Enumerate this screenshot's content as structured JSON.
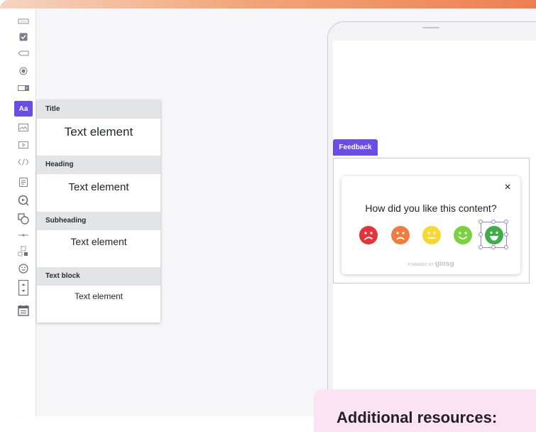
{
  "toolbar": {
    "items": [
      {
        "icon": "input-field-icon"
      },
      {
        "icon": "checkbox-icon"
      },
      {
        "icon": "label-tag-icon"
      },
      {
        "icon": "radio-icon"
      },
      {
        "icon": "dropdown-icon"
      },
      {
        "icon": "text-icon",
        "label": "Aa",
        "active": true
      },
      {
        "icon": "image-icon"
      },
      {
        "icon": "video-icon"
      },
      {
        "icon": "code-icon"
      },
      {
        "icon": "form-icon"
      },
      {
        "icon": "chat-bubble-icon"
      },
      {
        "icon": "shapes-icon"
      },
      {
        "icon": "divider-icon"
      },
      {
        "icon": "grid-select-icon"
      },
      {
        "icon": "emoji-rating-icon"
      },
      {
        "icon": "stepper-icon"
      },
      {
        "icon": "calendar-icon"
      }
    ]
  },
  "text_panel": {
    "sections": [
      {
        "heading": "Title",
        "sample": "Text element"
      },
      {
        "heading": "Heading",
        "sample": "Text element"
      },
      {
        "heading": "Subheading",
        "sample": "Text element"
      },
      {
        "heading": "Text block",
        "sample": "Text element"
      }
    ]
  },
  "preview": {
    "tag": "Feedback",
    "question": "How did you like this content?",
    "close": "×",
    "powered_prefix": "POWERED BY",
    "powered_brand": "giosg",
    "ratings": [
      {
        "icon": "very-unhappy-face-icon",
        "color": "#e3343c"
      },
      {
        "icon": "unhappy-face-icon",
        "color": "#f07d3f"
      },
      {
        "icon": "neutral-face-icon",
        "color": "#f4d834"
      },
      {
        "icon": "happy-face-icon",
        "color": "#7bd23f"
      },
      {
        "icon": "very-happy-face-icon",
        "color": "#3fae49"
      }
    ]
  },
  "resources": {
    "title": "Additional resources:"
  },
  "colors": {
    "accent": "#6a4de6"
  }
}
